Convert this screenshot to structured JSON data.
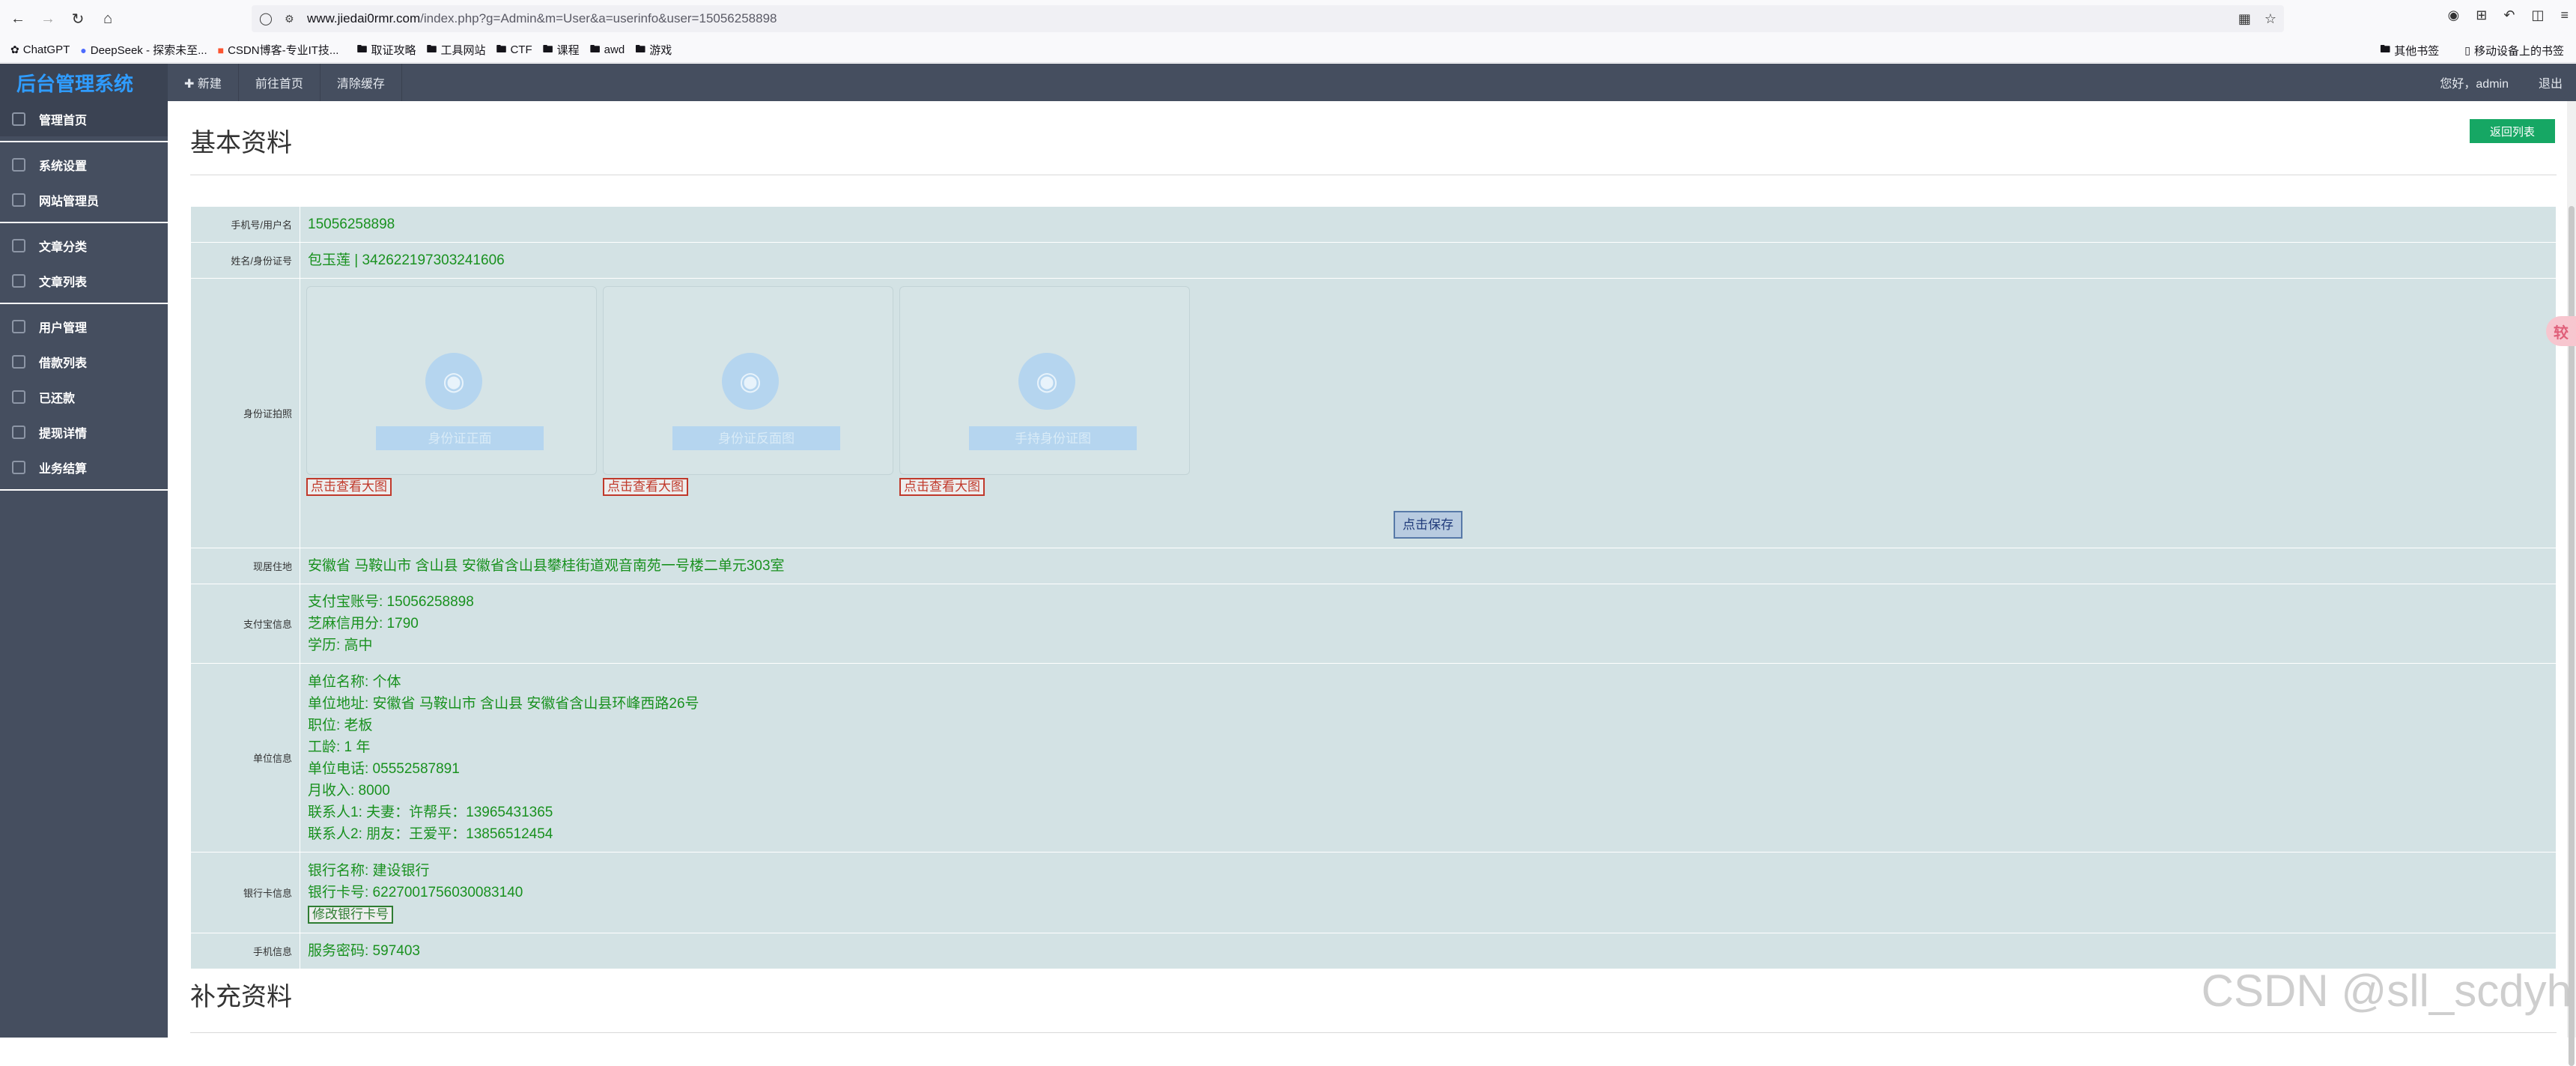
{
  "browser": {
    "url_host": "www.jiedai0rmr.com",
    "url_path": "/index.php?g=Admin&m=User&a=userinfo&user=15056258898",
    "bookmarks": [
      "ChatGPT",
      "DeepSeek - 探索未至...",
      "CSDN博客-专业IT技...",
      "取证攻略",
      "工具网站",
      "CTF",
      "课程",
      "awd",
      "游戏"
    ],
    "bookmarks_right": [
      "其他书签",
      "移动设备上的书签"
    ]
  },
  "header": {
    "logo": "后台管理系统",
    "links": [
      "✚ 新建",
      "前往首页",
      "清除缓存"
    ],
    "greeting": "您好，admin",
    "logout": "退出"
  },
  "sidebar": {
    "groups": [
      [
        "管理首页"
      ],
      [
        "系统设置",
        "网站管理员"
      ],
      [
        "文章分类",
        "文章列表"
      ],
      [
        "用户管理",
        "借款列表",
        "已还款",
        "提现详情",
        "业务结算"
      ]
    ]
  },
  "main": {
    "title": "基本资料",
    "back_button": "返回列表",
    "labels": {
      "phone": "手机号/用户名",
      "name_id": "姓名/身份证号",
      "id_photos": "身份证拍照",
      "address": "现居住地",
      "alipay": "支付宝信息",
      "company": "单位信息",
      "bank": "银行卡信息",
      "mobile": "手机信息"
    },
    "phone": "15056258898",
    "name_id": "包玉莲 | 342622197303241606",
    "photos": [
      {
        "label": "身份证正面",
        "button": "点击查看大图"
      },
      {
        "label": "身份证反面图",
        "button": "点击查看大图"
      },
      {
        "label": "手持身份证图",
        "button": "点击查看大图"
      }
    ],
    "save_button": "点击保存",
    "address": "安徽省 马鞍山市 含山县 安徽省含山县攀桂街道观音南苑一号楼二单元303室",
    "alipay": [
      "支付宝账号: 15056258898",
      "芝麻信用分: 1790",
      "学历: 高中"
    ],
    "company": [
      "单位名称: 个体",
      "单位地址: 安徽省 马鞍山市 含山县 安徽省含山县环峰西路26号",
      "职位: 老板",
      "工龄: 1 年",
      "单位电话: 05552587891",
      "月收入: 8000",
      "联系人1: 夫妻：许帮兵：13965431365",
      "联系人2: 朋友：王爱平：13856512454"
    ],
    "bank": [
      "银行名称: 建设银行",
      "银行卡号: 6227001756030083140"
    ],
    "bank_button": "修改银行卡号",
    "mobile": "服务密码: 597403",
    "sub_title": "补充资料"
  },
  "watermark": "CSDN @sll_scdyh",
  "float_tab": "较",
  "colors": {
    "header_bg": "#454e5f",
    "logo": "#2f9cff",
    "value_green": "#19911f",
    "back_button": "#16a764",
    "table_bg": "#d3e2e4"
  }
}
